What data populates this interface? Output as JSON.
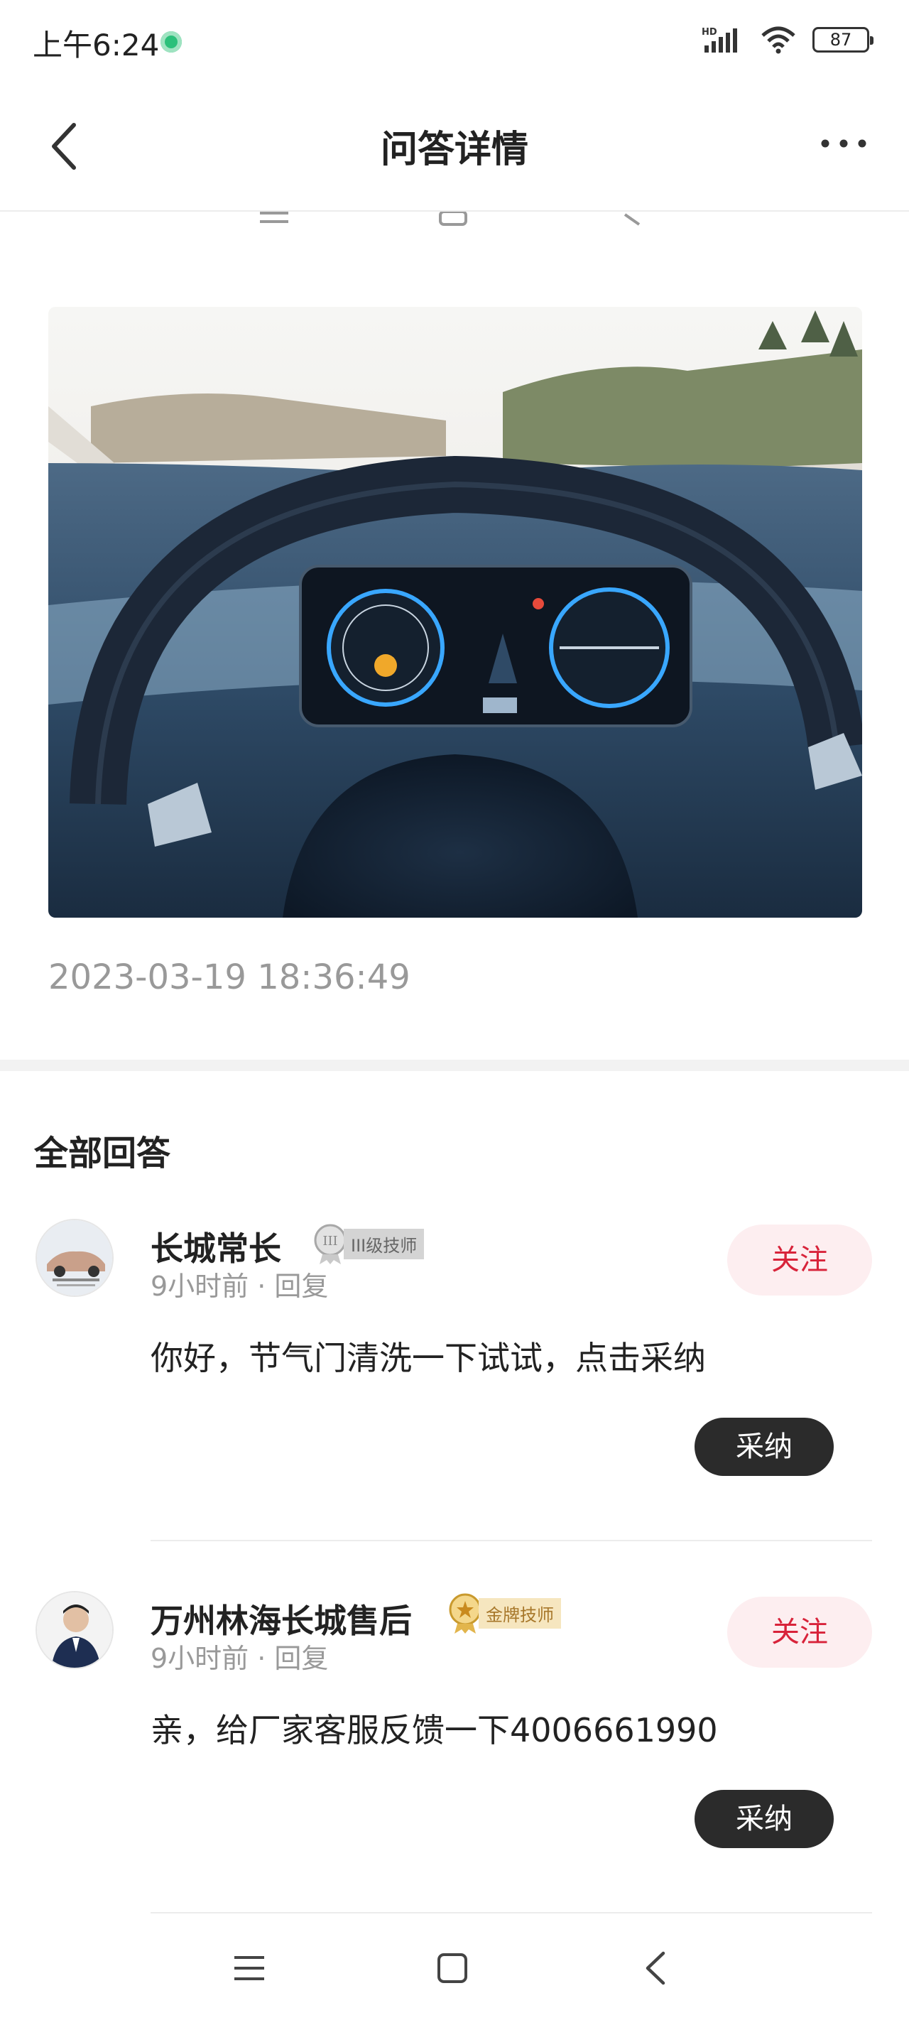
{
  "status_bar": {
    "time": "上午6:24",
    "network": "HD",
    "battery": "87"
  },
  "header": {
    "title": "问答详情"
  },
  "question": {
    "timestamp": "2023-03-19 18:36:49"
  },
  "answers_section": {
    "title": "全部回答",
    "answers": [
      {
        "name": "长城常长",
        "badge": "III级技师",
        "meta": "9小时前 · 回复",
        "follow_label": "关注",
        "content": "你好，节气门清洗一下试试，点击采纳",
        "accept_label": "采纳"
      },
      {
        "name": "万州林海长城售后",
        "badge": "金牌技师",
        "meta": "9小时前 · 回复",
        "follow_label": "关注",
        "content": "亲，给厂家客服反馈一下4006661990",
        "accept_label": "采纳"
      }
    ]
  },
  "colors": {
    "accent_red": "#d8233a",
    "follow_bg": "#fdeef0",
    "accept_bg": "#2b2b2b",
    "meta_gray": "#999999"
  },
  "icons": [
    "back-arrow-icon",
    "more-dots-icon",
    "signal-icon",
    "wifi-icon",
    "battery-icon",
    "menu-icon",
    "home-icon",
    "back-icon"
  ]
}
